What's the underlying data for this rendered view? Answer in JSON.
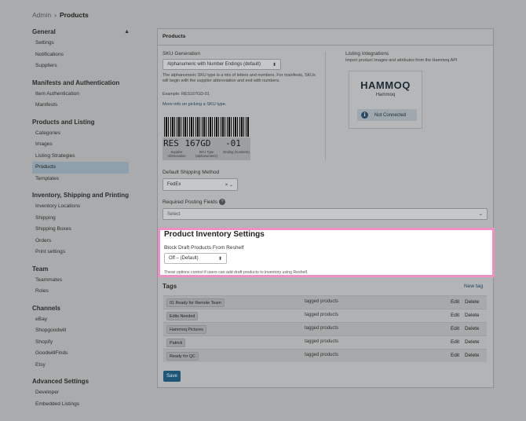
{
  "breadcrumb": {
    "root": "Admin",
    "separator": "›",
    "current": "Products"
  },
  "sidebar": {
    "sections": [
      {
        "title": "General",
        "collapsible": true,
        "items": [
          "Settings",
          "Notifications",
          "Suppliers"
        ]
      },
      {
        "title": "Manifests and Authentication",
        "items": [
          "Item Authentication",
          "Manifests"
        ]
      },
      {
        "title": "Products and Listing",
        "items": [
          "Categories",
          "Images",
          "Listing Strategies",
          "Products",
          "Templates"
        ],
        "active": "Products"
      },
      {
        "title": "Inventory, Shipping and Printing",
        "items": [
          "Inventory Locations",
          "Shipping",
          "Shipping Boxes",
          "Orders",
          "Print settings"
        ]
      },
      {
        "title": "Team",
        "items": [
          "Teammates",
          "Roles"
        ]
      },
      {
        "title": "Channels",
        "items": [
          "eBay",
          "Shopgoodwill",
          "Shopify",
          "GoodwillFinds",
          "Etsy"
        ]
      },
      {
        "title": "Advanced Settings",
        "items": [
          "Developer",
          "Embedded Listings"
        ]
      }
    ]
  },
  "panel": {
    "title": "Products",
    "sku": {
      "label": "SKU Generation",
      "selected": "Alphanumeric with Number Endings (default)",
      "description": "The alphanumeric SKU type is a mix of letters and numbers. For manifests, SKUs will begin with the supplier abbreviation and end with numbers.",
      "example": "Example: RES167GD-01",
      "link": "More info on picking a SKU type.",
      "barcode_text": "RES167GD-01",
      "barcode_segments": [
        "RES",
        "167GD",
        "-01"
      ],
      "barcode_captions": [
        "Supplier Abbreviation",
        "SKU Type (alphanumeric)",
        "Ending (numbers)"
      ]
    },
    "integrations": {
      "label": "Listing Integrations",
      "description": "Import product images and attributes from the Hammoq API",
      "logo_text": "HAMMOQ",
      "name": "Hammoq",
      "status": "Not Connected",
      "status_icon": "info-icon"
    },
    "shipping": {
      "label": "Default Shipping Method",
      "selected": "FedEx",
      "clear": "×",
      "chevron": "⌄"
    },
    "posting": {
      "label": "Required Posting Fields",
      "placeholder": "Select",
      "chevron": "⌄",
      "help": "?"
    },
    "inventory": {
      "title": "Product Inventory Settings",
      "label": "Block Draft Products From Reshelf",
      "selected": "Off – (Default)",
      "note": "These options control if users can add draft products to inventory using Reshelf."
    },
    "tags": {
      "title": "Tags",
      "new_tag": "New tag",
      "rows": [
        {
          "name": "01 Ready for Remote Team",
          "kind": "tagged products",
          "edit": "Edit",
          "delete": "Delete"
        },
        {
          "name": "Edits Needed",
          "kind": "tagged products",
          "edit": "Edit",
          "delete": "Delete"
        },
        {
          "name": "Hammoq Pictures",
          "kind": "tagged products",
          "edit": "Edit",
          "delete": "Delete"
        },
        {
          "name": "Patrick",
          "kind": "tagged products",
          "edit": "Edit",
          "delete": "Delete"
        },
        {
          "name": "Ready for QC",
          "kind": "tagged products",
          "edit": "Edit",
          "delete": "Delete"
        }
      ]
    },
    "save_label": "Save"
  },
  "colors": {
    "highlight_border": "#ee8fc6",
    "overlay": "#a9abac",
    "primary": "#1f5576"
  }
}
